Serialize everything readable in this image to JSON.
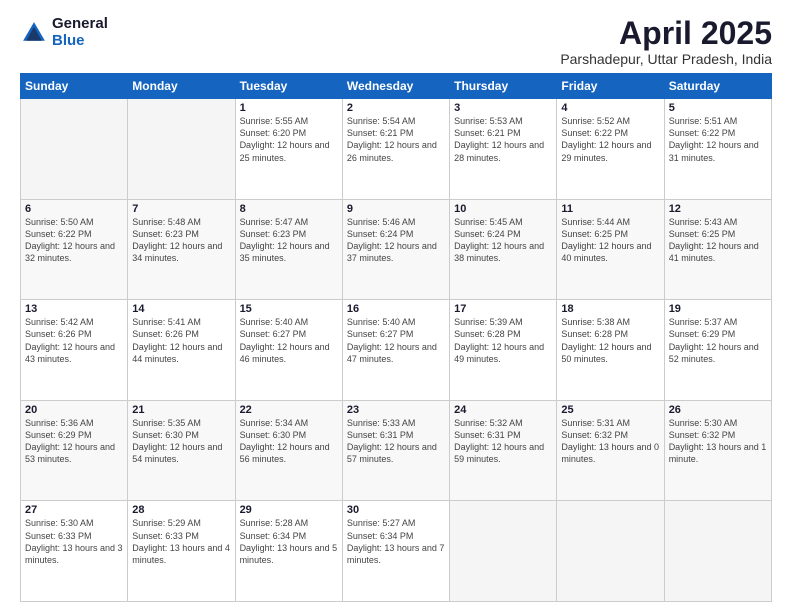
{
  "logo": {
    "general": "General",
    "blue": "Blue"
  },
  "header": {
    "title": "April 2025",
    "location": "Parshadepur, Uttar Pradesh, India"
  },
  "weekdays": [
    "Sunday",
    "Monday",
    "Tuesday",
    "Wednesday",
    "Thursday",
    "Friday",
    "Saturday"
  ],
  "rows": [
    [
      {
        "day": "",
        "info": ""
      },
      {
        "day": "",
        "info": ""
      },
      {
        "day": "1",
        "info": "Sunrise: 5:55 AM\nSunset: 6:20 PM\nDaylight: 12 hours and 25 minutes."
      },
      {
        "day": "2",
        "info": "Sunrise: 5:54 AM\nSunset: 6:21 PM\nDaylight: 12 hours and 26 minutes."
      },
      {
        "day": "3",
        "info": "Sunrise: 5:53 AM\nSunset: 6:21 PM\nDaylight: 12 hours and 28 minutes."
      },
      {
        "day": "4",
        "info": "Sunrise: 5:52 AM\nSunset: 6:22 PM\nDaylight: 12 hours and 29 minutes."
      },
      {
        "day": "5",
        "info": "Sunrise: 5:51 AM\nSunset: 6:22 PM\nDaylight: 12 hours and 31 minutes."
      }
    ],
    [
      {
        "day": "6",
        "info": "Sunrise: 5:50 AM\nSunset: 6:22 PM\nDaylight: 12 hours and 32 minutes."
      },
      {
        "day": "7",
        "info": "Sunrise: 5:48 AM\nSunset: 6:23 PM\nDaylight: 12 hours and 34 minutes."
      },
      {
        "day": "8",
        "info": "Sunrise: 5:47 AM\nSunset: 6:23 PM\nDaylight: 12 hours and 35 minutes."
      },
      {
        "day": "9",
        "info": "Sunrise: 5:46 AM\nSunset: 6:24 PM\nDaylight: 12 hours and 37 minutes."
      },
      {
        "day": "10",
        "info": "Sunrise: 5:45 AM\nSunset: 6:24 PM\nDaylight: 12 hours and 38 minutes."
      },
      {
        "day": "11",
        "info": "Sunrise: 5:44 AM\nSunset: 6:25 PM\nDaylight: 12 hours and 40 minutes."
      },
      {
        "day": "12",
        "info": "Sunrise: 5:43 AM\nSunset: 6:25 PM\nDaylight: 12 hours and 41 minutes."
      }
    ],
    [
      {
        "day": "13",
        "info": "Sunrise: 5:42 AM\nSunset: 6:26 PM\nDaylight: 12 hours and 43 minutes."
      },
      {
        "day": "14",
        "info": "Sunrise: 5:41 AM\nSunset: 6:26 PM\nDaylight: 12 hours and 44 minutes."
      },
      {
        "day": "15",
        "info": "Sunrise: 5:40 AM\nSunset: 6:27 PM\nDaylight: 12 hours and 46 minutes."
      },
      {
        "day": "16",
        "info": "Sunrise: 5:40 AM\nSunset: 6:27 PM\nDaylight: 12 hours and 47 minutes."
      },
      {
        "day": "17",
        "info": "Sunrise: 5:39 AM\nSunset: 6:28 PM\nDaylight: 12 hours and 49 minutes."
      },
      {
        "day": "18",
        "info": "Sunrise: 5:38 AM\nSunset: 6:28 PM\nDaylight: 12 hours and 50 minutes."
      },
      {
        "day": "19",
        "info": "Sunrise: 5:37 AM\nSunset: 6:29 PM\nDaylight: 12 hours and 52 minutes."
      }
    ],
    [
      {
        "day": "20",
        "info": "Sunrise: 5:36 AM\nSunset: 6:29 PM\nDaylight: 12 hours and 53 minutes."
      },
      {
        "day": "21",
        "info": "Sunrise: 5:35 AM\nSunset: 6:30 PM\nDaylight: 12 hours and 54 minutes."
      },
      {
        "day": "22",
        "info": "Sunrise: 5:34 AM\nSunset: 6:30 PM\nDaylight: 12 hours and 56 minutes."
      },
      {
        "day": "23",
        "info": "Sunrise: 5:33 AM\nSunset: 6:31 PM\nDaylight: 12 hours and 57 minutes."
      },
      {
        "day": "24",
        "info": "Sunrise: 5:32 AM\nSunset: 6:31 PM\nDaylight: 12 hours and 59 minutes."
      },
      {
        "day": "25",
        "info": "Sunrise: 5:31 AM\nSunset: 6:32 PM\nDaylight: 13 hours and 0 minutes."
      },
      {
        "day": "26",
        "info": "Sunrise: 5:30 AM\nSunset: 6:32 PM\nDaylight: 13 hours and 1 minute."
      }
    ],
    [
      {
        "day": "27",
        "info": "Sunrise: 5:30 AM\nSunset: 6:33 PM\nDaylight: 13 hours and 3 minutes."
      },
      {
        "day": "28",
        "info": "Sunrise: 5:29 AM\nSunset: 6:33 PM\nDaylight: 13 hours and 4 minutes."
      },
      {
        "day": "29",
        "info": "Sunrise: 5:28 AM\nSunset: 6:34 PM\nDaylight: 13 hours and 5 minutes."
      },
      {
        "day": "30",
        "info": "Sunrise: 5:27 AM\nSunset: 6:34 PM\nDaylight: 13 hours and 7 minutes."
      },
      {
        "day": "",
        "info": ""
      },
      {
        "day": "",
        "info": ""
      },
      {
        "day": "",
        "info": ""
      }
    ]
  ]
}
